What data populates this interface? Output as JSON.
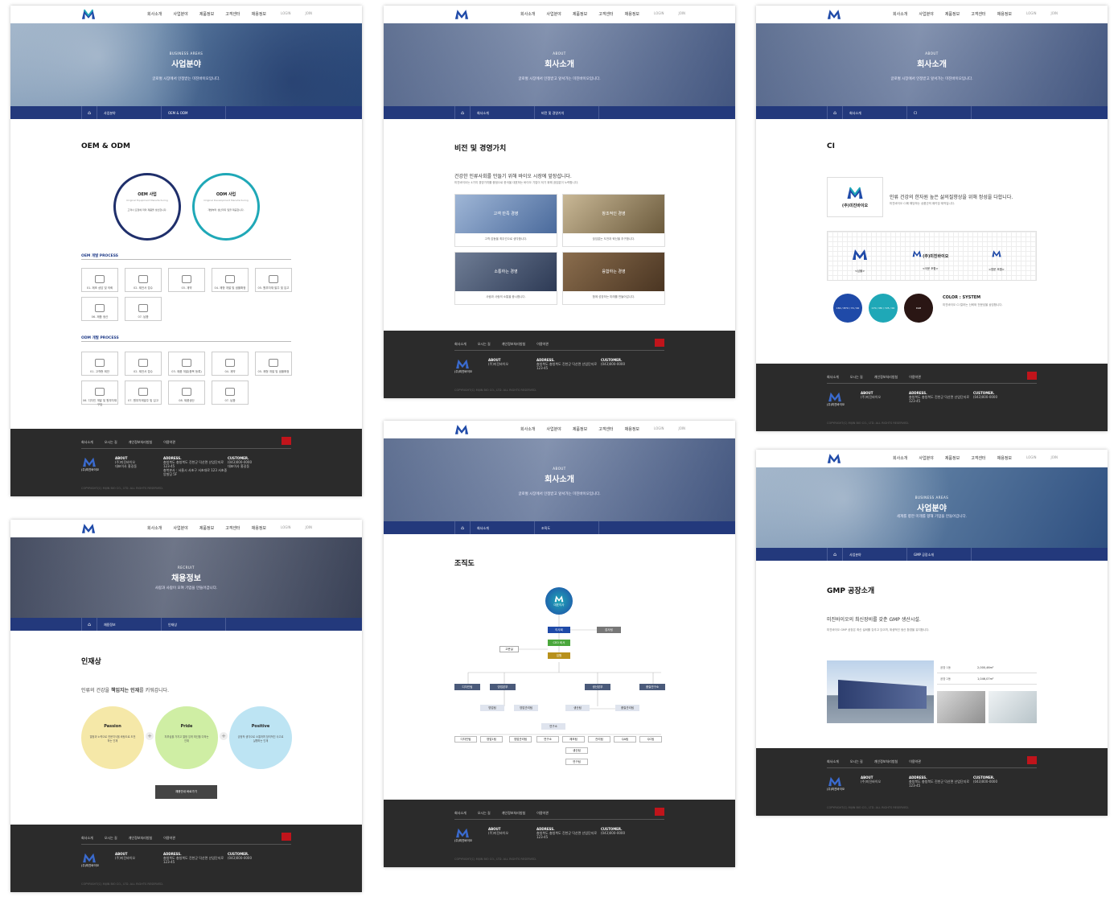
{
  "nav": {
    "items": [
      "회사소개",
      "사업분야",
      "제품정보",
      "고객센터",
      "채용정보"
    ],
    "login": "LOGIN",
    "join": "JOIN"
  },
  "footer": {
    "links": [
      "회사소개",
      "오시는 길",
      "개인정보처리방침",
      "이용약관"
    ],
    "top": "TOP",
    "logo_text": "(주)미진바이오",
    "about_title": "ABOUT",
    "about_lines": [
      "(주)미진바이오",
      "대표이사 홍길동",
      "사업자등록번호 123-45-67890"
    ],
    "address_title": "ADDRESS.",
    "address_lines": [
      "충청북도 충청북도 진천군 덕산면 산업단지로 123-45",
      "충북본사 : 서울시 서초구 서초대로 123 서초중앙빌딩 5F"
    ],
    "customer_title": "CUSTOMER.",
    "customer_lines": [
      "(043)000-0000",
      "대표이사 홍길동",
      "대표이메일 : mijinbio@email.com"
    ],
    "copyright": "COPYRIGHT(C) MIJIN BIO CO., LTD. ALL RIGHTS RESERVED."
  },
  "colors": {
    "navy": "#23397c",
    "footer": "#2b2b2b",
    "teal": "#1fa8b7",
    "red": "#c0141b"
  },
  "p1": {
    "hero_sub": "BUSINESS AREAS",
    "hero_title": "사업분야",
    "hero_desc": "글로벌 시장에서 인정받는 미진바이오입니다.",
    "lnb1": "사업분야",
    "lnb2": "OEM & ODM",
    "section": "OEM & ODM",
    "oem_title": "OEM 사업",
    "oem_sub": "Original Equipment Manufacturing",
    "oem_desc": "고객사 요청에 따라 제품을 생산합니다.",
    "odm_title": "ODM 사업",
    "odm_sub": "Original Development Manufacturing",
    "odm_desc": "개발부터 생산까지 일괄 제공합니다.",
    "oem_process": "OEM 개발 PROCESS",
    "oem_steps": [
      "01. 제조 상담 및 의뢰",
      "02. 제안서 접수",
      "03. 계약",
      "04. 제형 개발 및 샘플확정",
      "05. 원부자재 발주 및 입고",
      "06. 제품 생산",
      "07. 납품"
    ],
    "odm_process": "ODM 개발 PROCESS",
    "odm_steps": [
      "01. 고객층 제안",
      "02. 제안서 접수",
      "03. 제품 개발(품목 등록)",
      "04. 계약",
      "05. 제형 개발 및 샘플확정",
      "06. 디자인 개발 및 원부자재구입",
      "07. 원부자재발주 및 입고",
      "08. 제품생산",
      "07. 납품"
    ]
  },
  "p2": {
    "hero_sub": "ABOUT",
    "hero_title": "회사소개",
    "hero_desc": "글로벌 시장에서 인정받고 앞서가는 미진바이오입니다.",
    "lnb1": "회사소개",
    "lnb2": "비전 및 경영가치",
    "section": "비전 및 경영가치",
    "headline": "건강한 인류사회를 만들기 위해 바이오 시장에 앞장섭니다.",
    "desc": "미진바이오는 4가지 경영가치를 중점으로 한국을 대표하는 바이오 기업이 되기 위해 끊임없이 노력합니다.",
    "cards": [
      {
        "title": "고객 만족 경영",
        "desc": "고객 감동을 최우선으로 생각합니다."
      },
      {
        "title": "창조적인 경영",
        "desc": "끊임없는 도전과 혁신을 추구합니다."
      },
      {
        "title": "소통하는 경영",
        "desc": "사람과 사람의 소통을 중시합니다."
      },
      {
        "title": "융합하는 경영",
        "desc": "함께 성장하는 미래를 만들어갑니다."
      }
    ]
  },
  "p3": {
    "hero_sub": "ABOUT",
    "hero_title": "회사소개",
    "hero_desc": "글로벌 시장에서 인정받고 앞서가는 미진바이오입니다.",
    "lnb1": "회사소개",
    "lnb2": "CI",
    "section": "CI",
    "ci_text": "(주)미진바이오",
    "headline": "인류 건강의 한자원 높은 삶의질향상을 위해 정성을 다합니다.",
    "desc": "미진바이오 CI에 해당하는 상품군의 패키징 제작입니다.",
    "variants": [
      "<심볼>",
      "<국문 조합>",
      "<영문 조합>"
    ],
    "colors": [
      {
        "label": "C80 / M70 / Y0 / K0",
        "hex": "#1f4aa8"
      },
      {
        "label": "C70 / M0 / Y25 / K0",
        "hex": "#1fa8b7"
      },
      {
        "label": "RGB",
        "hex": "#2a1614"
      }
    ],
    "color_title": "COLOR : SYSTEM",
    "color_desc": "미진바이오 CI 컬러는 신뢰와 전문성을 상징합니다."
  },
  "p4": {
    "hero_sub": "ABOUT",
    "hero_title": "회사소개",
    "hero_desc": "글로벌 시장에서 인정받고 앞서가는 미진바이오입니다.",
    "lnb1": "회사소개",
    "lnb2": "조직도",
    "section": "조직도",
    "ceo": "대표이사",
    "board": "이사회",
    "audit": "감사팀",
    "ceo_office": "CEO 비서",
    "exec": "임원",
    "advisor": "고문실",
    "divisions": [
      "디자인팀",
      "영업본부",
      "생산본부",
      "품질연구소"
    ],
    "subs": [
      "영업팀",
      "영업관리팀",
      "생산팀",
      "품질관리팀",
      "연구소"
    ],
    "teams": [
      "디자인팀",
      "영업1팀",
      "영업관리팀",
      "연구소",
      "제조팀",
      "관리팀",
      "QA팀",
      "QC팀",
      "생산팀",
      "연구팀"
    ]
  },
  "p5": {
    "hero_sub": "RECRUIT",
    "hero_title": "채용정보",
    "hero_desc": "사람과 사람이 모여 기업을 만들어갑니다.",
    "lnb1": "채용정보",
    "lnb2": "인재상",
    "section": "인재상",
    "headline_a": "인류의 건강을 ",
    "headline_b": "책임지는 인재",
    "headline_c": "를 키워갑니다.",
    "circles": [
      {
        "title": "Passion",
        "desc": "열정과 노력으로 전문지식을 바탕으로 도전하는 인재",
        "color": "#f5e8a8"
      },
      {
        "title": "Pride",
        "desc": "자부심을 가지고 열정 있게 최선을 다하는 인재",
        "color": "#cfeea4"
      },
      {
        "title": "Positive",
        "desc": "긍정적 생각으로 소통하며 창의적인 사고로 실행하는 인재",
        "color": "#bde4f3"
      }
    ],
    "button": "채용안내 바로가기"
  },
  "p6": {
    "hero_sub": "BUSINESS AREAS",
    "hero_title": "사업분야",
    "hero_desc": "세계를 향한 미래를 향해 기업을 만들어갑니다.",
    "lnb1": "사업분야",
    "lnb2": "GMP 공장소개",
    "section": "GMP 공장소개",
    "headline": "미진바이오의 최신장비를 갖춘 GMP 생산시설.",
    "desc": "미진바이오 GMP 공장은 최신 설비를 갖추고 있으며, 위생적인 생산 환경을 유지합니다.",
    "specs": [
      {
        "k": "공장 1동",
        "v": "2,000,46m²"
      },
      {
        "k": "공장 2동",
        "v": "1,046,07m²"
      }
    ]
  }
}
